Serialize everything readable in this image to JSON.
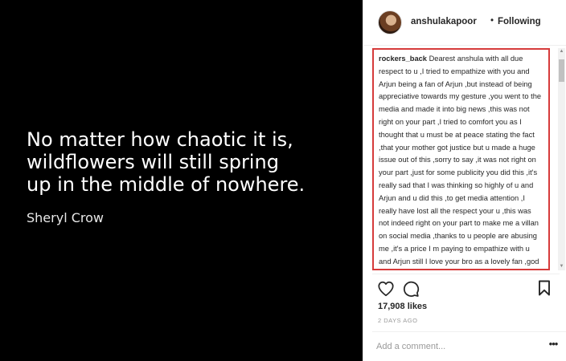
{
  "post_image": {
    "quote_line1": "No matter how chaotic it is,",
    "quote_line2": "wildflowers will still spring",
    "quote_line3": "up in the middle of nowhere.",
    "author": "Sheryl Crow"
  },
  "header": {
    "username": "anshulakapoor",
    "separator": "•",
    "follow_status": "Following",
    "avatar_icon": "profile-photo"
  },
  "comment": {
    "user": "rockers_back",
    "text": "Dearest anshula with all due respect to u ,I tried to empathize with you and Arjun being a fan of Arjun ,but instead of being appreciative towards my gesture ,you went to the media and made it into big news ,this was not right on your part ,I tried to comfort you as I thought that u must be at peace stating the fact ,that your mother got justice but u made a huge issue out of this ,sorry to say ,it was not right on your part ,just for some publicity you did this ,it's really sad that I was thinking so highly of u and Arjun and u did this ,to get media attention ,I really have lost all the respect your u ,this was not indeed right on your part to make me a villan on social media ,thanks to u people are abusing me ,it's a price I m paying to empathize with u and Arjun still I love your bro as a lovely fan ,god bless u",
    "highlight_color": "#d63b3b"
  },
  "actions": {
    "like_icon": "heart-icon",
    "comment_icon": "speech-bubble-icon",
    "save_icon": "bookmark-icon"
  },
  "stats": {
    "likes": "17,908 likes",
    "timestamp": "2 DAYS AGO"
  },
  "footer": {
    "comment_placeholder": "Add a comment...",
    "more_icon": "ellipsis-icon",
    "more_glyph": "•••"
  }
}
